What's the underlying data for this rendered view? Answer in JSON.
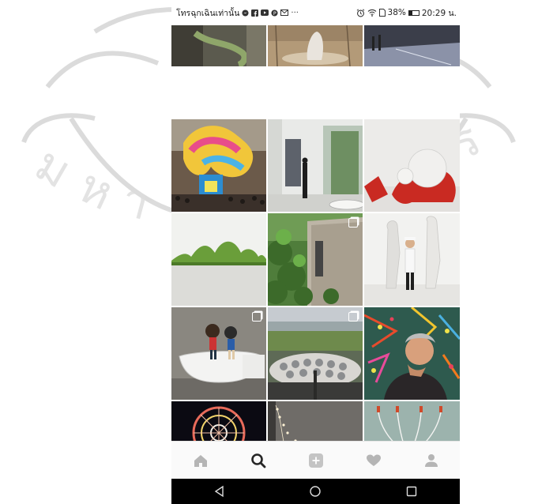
{
  "status_bar": {
    "carrier_text": "โทรฉุกเฉินเท่านั้น",
    "more_text": "···",
    "battery_percent": "38%",
    "time": "20:29 น."
  },
  "grid": {
    "columns": 3,
    "tiles": [
      {
        "id": "sculpture-installation",
        "multi": false
      },
      {
        "id": "outdoor-stone-sculpture",
        "multi": false
      },
      {
        "id": "dark-gallery-room",
        "multi": false
      },
      {
        "id": "colorful-giant-figure",
        "multi": false
      },
      {
        "id": "white-gallery-visitor",
        "multi": false
      },
      {
        "id": "red-white-sculpture",
        "multi": false
      },
      {
        "id": "green-hills-sculpture",
        "multi": false
      },
      {
        "id": "building-in-forest",
        "multi": true
      },
      {
        "id": "white-statues",
        "multi": false
      },
      {
        "id": "figures-in-bathtub",
        "multi": true
      },
      {
        "id": "metal-cup-field",
        "multi": true
      },
      {
        "id": "man-with-paint-splatter",
        "multi": false
      },
      {
        "id": "neon-ferris-wheel",
        "multi": false
      },
      {
        "id": "light-branches",
        "multi": false
      },
      {
        "id": "hanging-wires",
        "multi": false
      }
    ]
  },
  "tab_bar": {
    "active": "search",
    "icons": [
      "home-icon",
      "search-icon",
      "add-icon",
      "heart-icon",
      "profile-icon"
    ]
  },
  "nav_bar": {
    "icons": [
      "back-icon",
      "home-circle-icon",
      "recents-icon"
    ]
  }
}
